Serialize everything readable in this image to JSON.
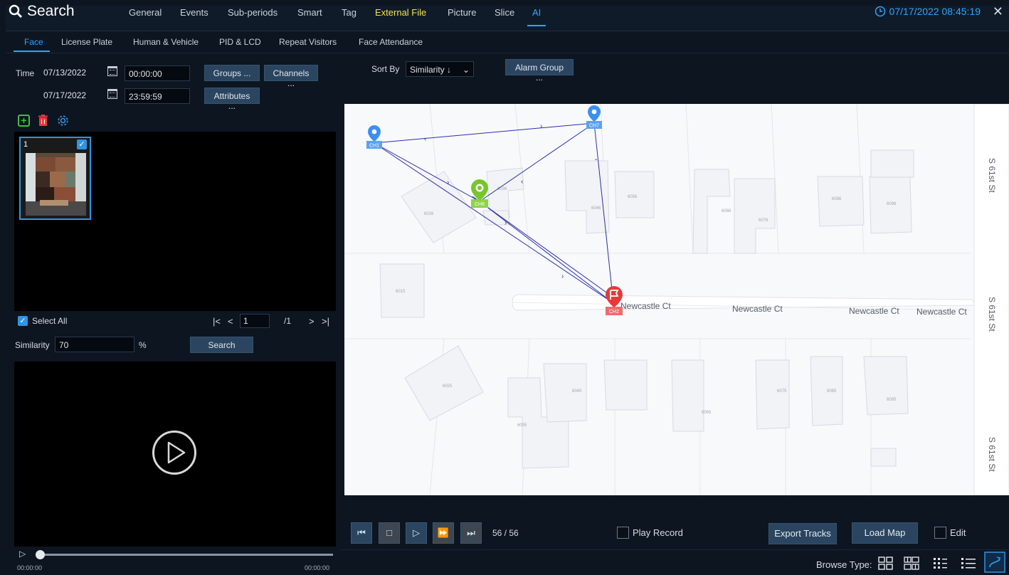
{
  "header": {
    "title": "Search",
    "tabs": [
      "General",
      "Events",
      "Sub-periods",
      "Smart",
      "Tag",
      "External File",
      "Picture",
      "Slice",
      "AI"
    ],
    "active_tab": "AI",
    "datetime": "07/17/2022 08:45:19"
  },
  "subtabs": [
    "Face",
    "License Plate",
    "Human & Vehicle",
    "PID & LCD",
    "Repeat Visitors",
    "Face Attendance"
  ],
  "active_subtab": "Face",
  "filters": {
    "time_label": "Time",
    "start_date": "07/13/2022",
    "start_time": "00:00:00",
    "end_date": "07/17/2022",
    "end_time": "23:59:59",
    "groups_btn": "Groups ...",
    "channels_btn": "Channels ...",
    "attributes_btn": "Attributes ...",
    "sort_by_label": "Sort By",
    "sort_value": "Similarity ↓",
    "alarm_group_btn": "Alarm Group ..."
  },
  "faces": [
    {
      "index": "1",
      "checked": true
    }
  ],
  "selection": {
    "select_all": "Select All",
    "page": "1",
    "page_total": "/1",
    "similarity_label": "Similarity",
    "similarity_value": "70",
    "percent": "%",
    "search_btn": "Search"
  },
  "playback": {
    "time_start": "00:00:00",
    "time_end": "00:00:00"
  },
  "map": {
    "street_label": "Newcastle Ct",
    "cross_street": "S 61st St",
    "lots": [
      "6026",
      "6036",
      "6046",
      "6056",
      "6066",
      "6076",
      "6086",
      "6096",
      "6015",
      "6025",
      "6035",
      "6045",
      "6065",
      "6075",
      "6085",
      "6095"
    ],
    "markers": [
      {
        "label": "CH1",
        "color": "#3b8ff0"
      },
      {
        "label": "CH7",
        "color": "#3b8ff0"
      },
      {
        "label": "CH6",
        "color": "#77c62b"
      },
      {
        "label": "CH2",
        "color": "#e8383a"
      }
    ]
  },
  "track_controls": {
    "counter": "56 / 56",
    "play_record": "Play Record",
    "export_tracks": "Export Tracks",
    "load_map": "Load Map",
    "edit": "Edit",
    "browse_type": "Browse Type:"
  }
}
